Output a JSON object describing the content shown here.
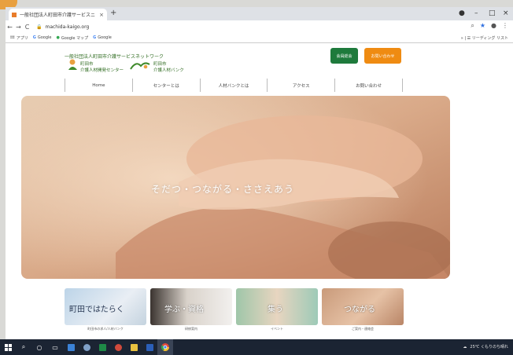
{
  "browser": {
    "tab_title": "一般社団法人町田市介護サービスニ",
    "tab_close": "×",
    "new_tab": "+",
    "window_controls": [
      "●",
      "–",
      "□",
      "×"
    ],
    "nav": {
      "back": "←",
      "forward": "→",
      "reload": "C"
    },
    "url": "machida-kaigo.org",
    "toolbar_icons": [
      "search-icon",
      "star-icon",
      "account-icon",
      "menu-icon"
    ],
    "toolbar_glyphs": [
      "⌕",
      "★",
      "●",
      "⋮"
    ],
    "bookmarks": [
      {
        "icon": "apps-icon",
        "label": "アプリ"
      },
      {
        "icon": "google-icon",
        "label": "Google"
      },
      {
        "icon": "maps-icon",
        "label": "Google マップ"
      },
      {
        "icon": "google-icon",
        "label": "Google"
      }
    ],
    "reading_list": "» | ☰ リーディング リスト"
  },
  "site": {
    "org_name": "一般社団法人町田市介護サービスネットワーク",
    "logo1": {
      "line1": "町田市",
      "line2": "介護人材開発センター"
    },
    "logo2": {
      "line1": "町田市",
      "line2": "介護人材バンク"
    },
    "btn_member": "会員総会",
    "btn_contact": "お問い合わせ",
    "nav": [
      "Home",
      "センターとは",
      "人材バンクとは",
      "アクセス",
      "お問い合わせ"
    ],
    "hero_text": "そだつ・つながる・ささえあう",
    "cards": [
      {
        "title": "町田ではたらく",
        "caption": "町田市の求人/人材バンク"
      },
      {
        "title": "学ぶ・資格",
        "caption": "研修案内"
      },
      {
        "title": "集う",
        "caption": "イベント"
      },
      {
        "title": "つながる",
        "caption": "ご案内・連絡会"
      }
    ],
    "colors": {
      "green": "#1e7a3c",
      "orange": "#ef8b12",
      "text_green": "#2e6b1f"
    }
  },
  "taskbar": {
    "tray_text": "25℃ くもりのち晴れ",
    "icons": [
      "windows-icon",
      "search-icon",
      "cortana-icon",
      "task-view-icon",
      "store-icon",
      "paint-icon",
      "spreadsheet-icon",
      "photos-icon",
      "explorer-icon",
      "word-icon",
      "chrome-icon"
    ]
  }
}
